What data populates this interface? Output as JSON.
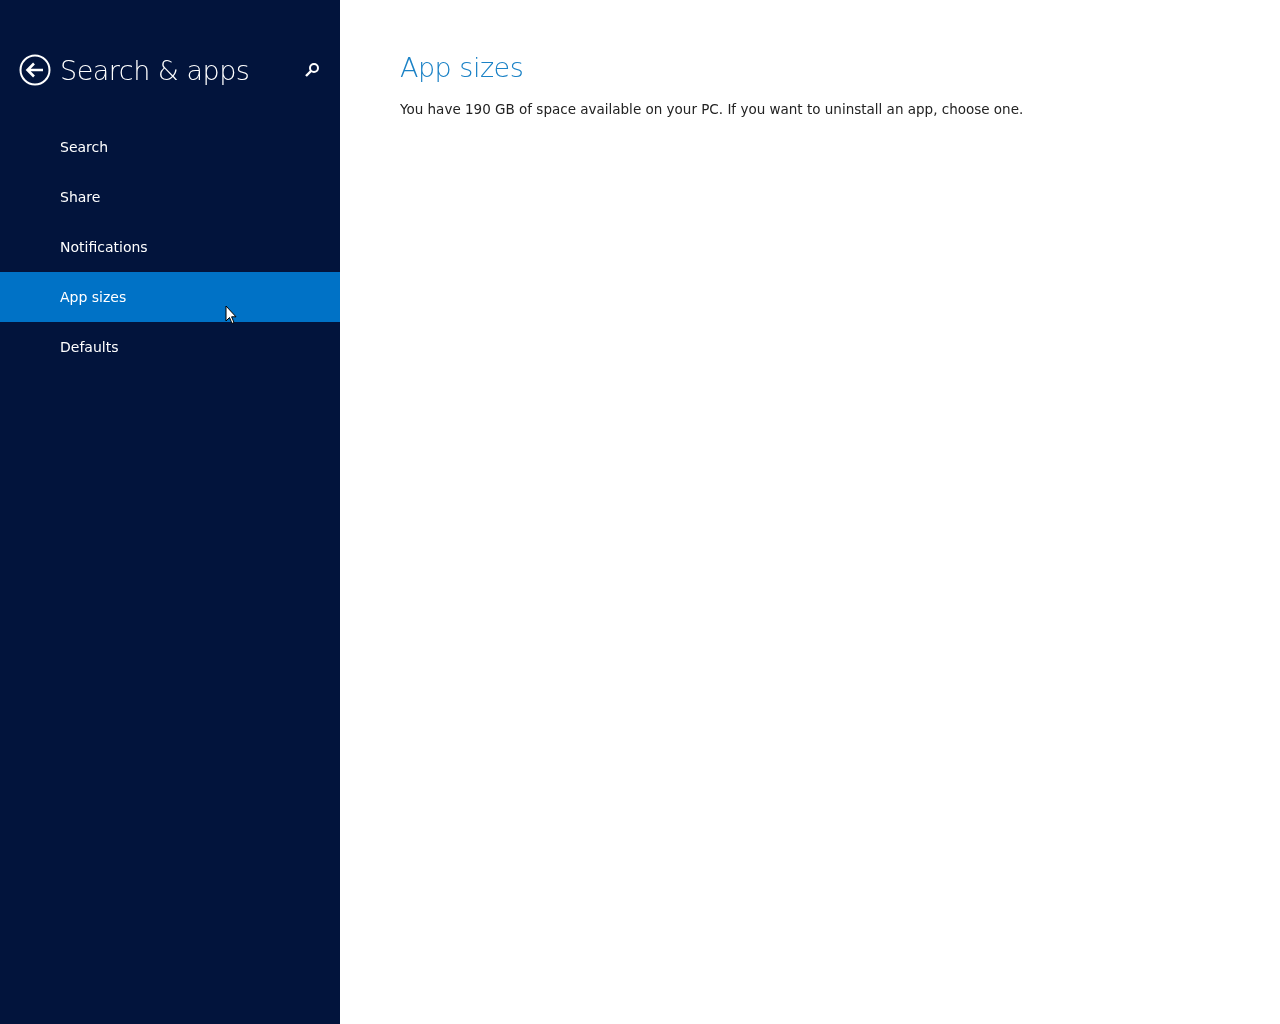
{
  "sidebar": {
    "title": "Search & apps",
    "items": [
      {
        "label": "Search",
        "selected": false
      },
      {
        "label": "Share",
        "selected": false
      },
      {
        "label": "Notifications",
        "selected": false
      },
      {
        "label": "App sizes",
        "selected": true
      },
      {
        "label": "Defaults",
        "selected": false
      }
    ]
  },
  "content": {
    "heading": "App sizes",
    "text": "You have 190 GB of space available on your PC. If you want to uninstall an app, choose one."
  }
}
